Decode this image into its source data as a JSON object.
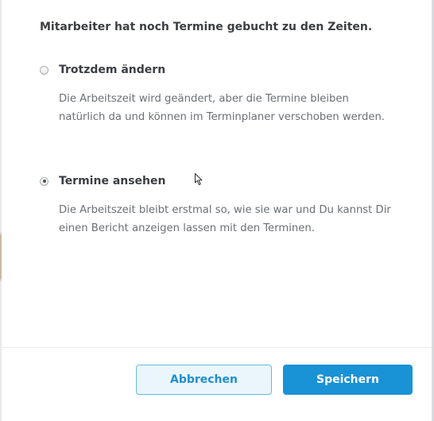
{
  "dialog": {
    "heading": "Mitarbeiter hat noch Termine gebucht zu den Zeiten.",
    "options": [
      {
        "label": "Trotzdem ändern",
        "description": "Die Arbeitszeit wird geändert, aber die Termine bleiben natürlich da und können im Terminplaner verschoben werden.",
        "selected": false
      },
      {
        "label": "Termine ansehen",
        "description": "Die Arbeitszeit bleibt erstmal so, wie sie war und Du kannst Dir einen Bericht anzeigen lassen mit den Terminen.",
        "selected": true
      }
    ]
  },
  "footer": {
    "cancel_label": "Abbrechen",
    "save_label": "Speichern"
  },
  "colors": {
    "primary": "#1a92d6",
    "cancel_bg": "#eaf6fc",
    "cancel_border": "#6bb8df",
    "text_dark": "#3a3f44",
    "text_muted": "#6b7075"
  }
}
